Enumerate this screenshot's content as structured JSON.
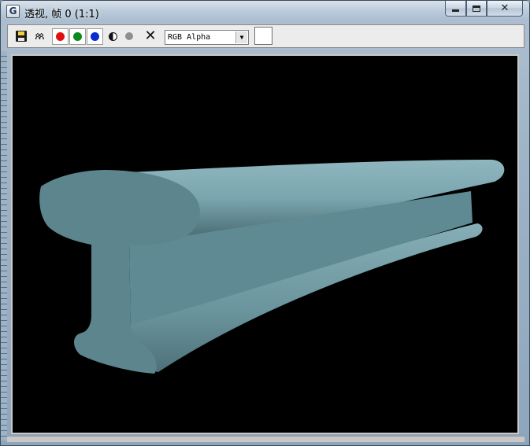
{
  "window": {
    "title": "透视, 帧 0 (1:1)",
    "app_icon_letter": "G"
  },
  "toolbar": {
    "save_icon": "floppy-disk-icon",
    "clone_icon": "clone-window-icon",
    "channels": [
      {
        "name": "red-channel",
        "color": "#e01010"
      },
      {
        "name": "green-channel",
        "color": "#0c8a1e"
      },
      {
        "name": "blue-channel",
        "color": "#0a2bd0"
      }
    ],
    "mono_icon": "monochrome-icon",
    "alpha_icon": "alpha-channel-icon",
    "clear_icon": "clear-icon",
    "channel_select": {
      "value": "RGB Alpha"
    },
    "swatch_color": "#ffffff"
  },
  "viewport": {
    "background": "#000000",
    "object_color": "#6e98a2"
  }
}
